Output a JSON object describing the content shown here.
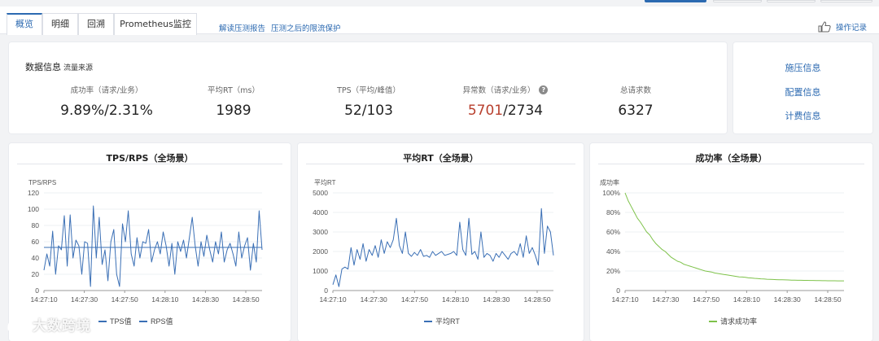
{
  "tabs": [
    {
      "label": "概览",
      "active": true
    },
    {
      "label": "明细",
      "active": false
    },
    {
      "label": "回溯",
      "active": false
    },
    {
      "label": "Prometheus监控",
      "active": false
    }
  ],
  "links": {
    "report": "解读压测报告",
    "throttle": "压测之后的限流保护",
    "oplog": "操作记录"
  },
  "info": {
    "title": "数据信息",
    "subtitle": "流量来源",
    "metrics": [
      {
        "label": "成功率（请求/业务）",
        "value": "9.89%/2.31%"
      },
      {
        "label": "平均RT（ms）",
        "value": "1989"
      },
      {
        "label": "TPS（平均/峰值）",
        "value": "52/103"
      },
      {
        "label": "异常数（请求/业务）",
        "value_red": "5701",
        "value_rest": "/2734",
        "help": "?"
      },
      {
        "label": "总请求数",
        "value": "6327"
      }
    ]
  },
  "side": {
    "items": [
      "施压信息",
      "配置信息",
      "计费信息"
    ]
  },
  "colors": {
    "accent": "#2c6ab1",
    "danger": "#b8402e",
    "line_blue": "#3a6fb5",
    "line_green": "#7ec24a"
  },
  "chart_data": [
    {
      "type": "line",
      "title": "TPS/RPS（全场景）",
      "ylabel": "TPS/RPS",
      "ylim": [
        0,
        120
      ],
      "yticks": [
        0,
        20,
        40,
        60,
        80,
        100,
        120
      ],
      "xticks": [
        "14:27:10",
        "14:27:30",
        "14:27:50",
        "14:28:10",
        "14:28:30",
        "14:28:50"
      ],
      "series": [
        {
          "name": "TPS值",
          "color": "#3a6fb5",
          "values": [
            25,
            45,
            30,
            73,
            20,
            55,
            50,
            92,
            30,
            93,
            40,
            62,
            55,
            20,
            60,
            58,
            5,
            104,
            40,
            90,
            32,
            50,
            12,
            60,
            75,
            20,
            5,
            82,
            60,
            98,
            45,
            30,
            65,
            40,
            60,
            58,
            75,
            35,
            50,
            60,
            45,
            72,
            55,
            30,
            58,
            20,
            60,
            48,
            62,
            40,
            65,
            90,
            55,
            30,
            60,
            42,
            68,
            50,
            35,
            60,
            45,
            72,
            35,
            50,
            58,
            45,
            30,
            72,
            40,
            55,
            65,
            25,
            58,
            35,
            98,
            50
          ]
        },
        {
          "name": "RPS值",
          "color": "#3a6fb5",
          "values": [
            53,
            53
          ]
        }
      ]
    },
    {
      "type": "line",
      "title": "平均RT（全场景）",
      "ylabel": "平均RT",
      "ylim": [
        0,
        5000
      ],
      "yticks": [
        0,
        1000,
        2000,
        3000,
        4000,
        5000
      ],
      "xticks": [
        "14:27:10",
        "14:27:30",
        "14:27:50",
        "14:28:10",
        "14:28:30",
        "14:28:50"
      ],
      "series": [
        {
          "name": "平均RT",
          "color": "#3a6fb5",
          "values": [
            300,
            800,
            200,
            1100,
            1200,
            1100,
            2200,
            1300,
            2100,
            1600,
            2400,
            1500,
            2100,
            1800,
            2300,
            1700,
            2600,
            1900,
            2500,
            2200,
            2600,
            3700,
            2300,
            1900,
            3000,
            1900,
            1750,
            1950,
            1800,
            2100,
            1750,
            1800,
            1700,
            2000,
            1800,
            1900,
            2000,
            1800,
            1850,
            1900,
            2000,
            1800,
            3500,
            2100,
            1800,
            3700,
            1850,
            2000,
            1600,
            3000,
            1700,
            1900,
            1800,
            1500,
            1900,
            1700,
            2000,
            1800,
            1600,
            1900,
            2000,
            1800,
            2400,
            1700,
            2800,
            1900,
            2200,
            1800,
            1300,
            4200,
            1900,
            3300,
            3000,
            1800
          ]
        }
      ]
    },
    {
      "type": "line",
      "title": "成功率（全场景）",
      "ylabel": "成功率",
      "ylim": [
        0,
        100
      ],
      "yticks": [
        0,
        20,
        40,
        60,
        80,
        100
      ],
      "ytick_labels": [
        "0",
        "20%",
        "40%",
        "60%",
        "80%",
        "100%"
      ],
      "xticks": [
        "14:27:10",
        "14:27:30",
        "14:27:50",
        "14:28:10",
        "14:28:30",
        "14:28:50"
      ],
      "series": [
        {
          "name": "请求成功率",
          "color": "#7ec24a",
          "values": [
            100,
            92,
            86,
            80,
            74,
            70,
            65,
            60,
            57,
            52,
            48,
            45,
            42,
            40,
            37,
            34,
            32,
            30,
            29,
            27,
            26,
            25,
            24,
            23,
            22,
            21,
            20,
            19.5,
            19,
            18,
            17.5,
            17,
            16.5,
            16,
            15.5,
            15,
            14.5,
            14,
            13.8,
            13.5,
            13,
            12.8,
            12.5,
            12.3,
            12,
            11.8,
            11.6,
            11.5,
            11.3,
            11.2,
            11,
            11,
            10.9,
            10.8,
            10.7,
            10.6,
            10.5,
            10.5,
            10.4,
            10.4,
            10.3,
            10.3,
            10.2,
            10.2,
            10.1,
            10.1,
            10,
            10,
            10,
            9.9,
            9.9,
            9.9
          ]
        }
      ]
    }
  ],
  "watermark": "大数跨境"
}
